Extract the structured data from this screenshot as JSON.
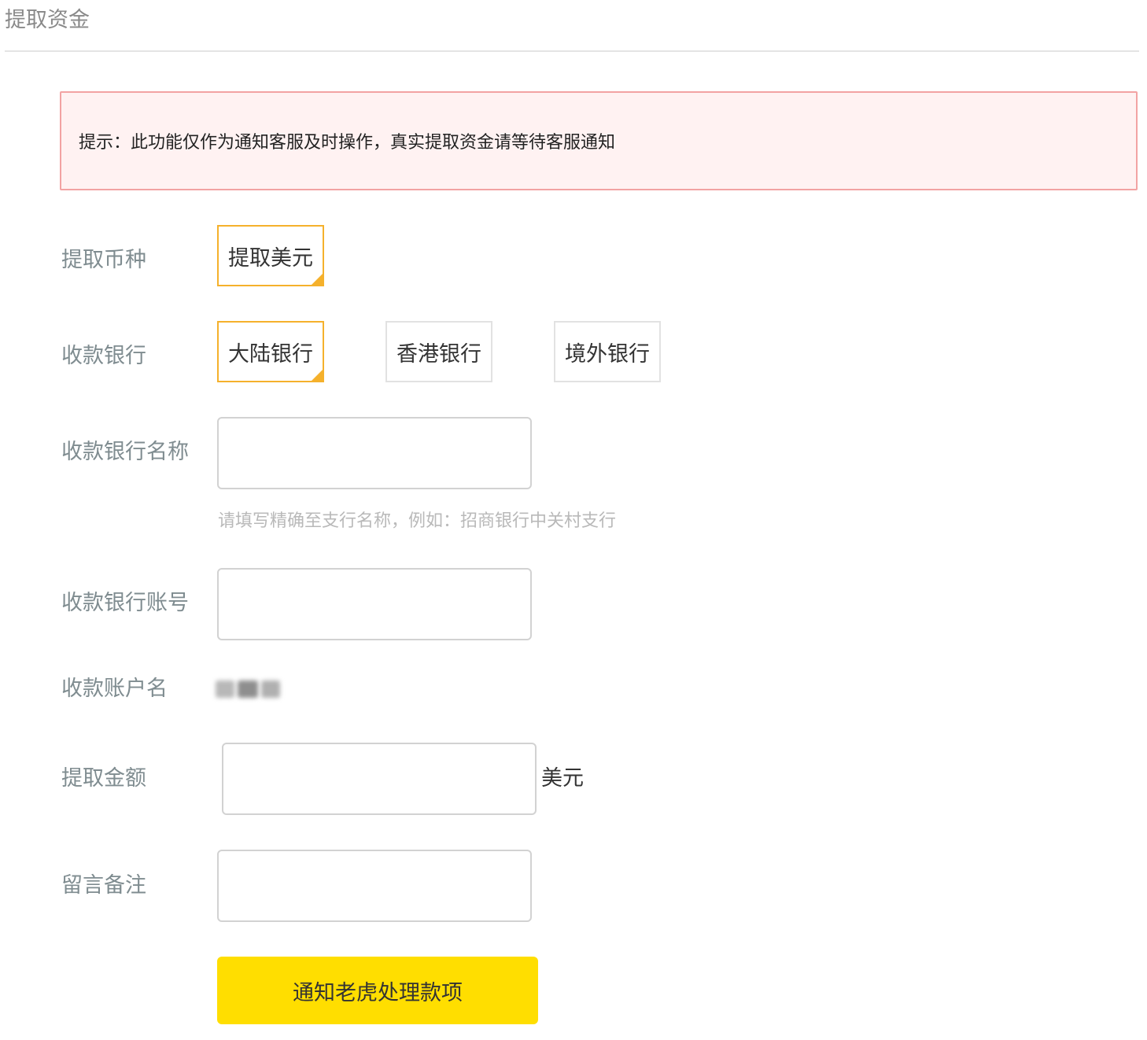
{
  "page": {
    "title": "提取资金"
  },
  "notice": {
    "text": "提示：此功能仅作为通知客服及时操作，真实提取资金请等待客服通知"
  },
  "currency": {
    "label": "提取币种",
    "options": [
      {
        "label": "提取美元",
        "selected": true
      }
    ]
  },
  "bank_type": {
    "label": "收款银行",
    "options": [
      {
        "label": "大陆银行",
        "selected": true
      },
      {
        "label": "香港银行",
        "selected": false
      },
      {
        "label": "境外银行",
        "selected": false
      }
    ]
  },
  "bank_name": {
    "label": "收款银行名称",
    "value": "",
    "placeholder": "",
    "hint": "请填写精确至支行名称，例如：招商银行中关村支行"
  },
  "bank_account": {
    "label": "收款银行账号",
    "value": "",
    "placeholder": ""
  },
  "account_name": {
    "label": "收款账户名"
  },
  "amount": {
    "label": "提取金额",
    "value": "",
    "placeholder": "",
    "unit": "美元"
  },
  "remark": {
    "label": "留言备注",
    "value": "",
    "placeholder": ""
  },
  "submit": {
    "label": "通知老虎处理款项"
  },
  "colors": {
    "accent": "#f5b12c",
    "button": "#ffde00",
    "notice_bg": "#fff2f2",
    "notice_border": "#f2a3a3"
  }
}
